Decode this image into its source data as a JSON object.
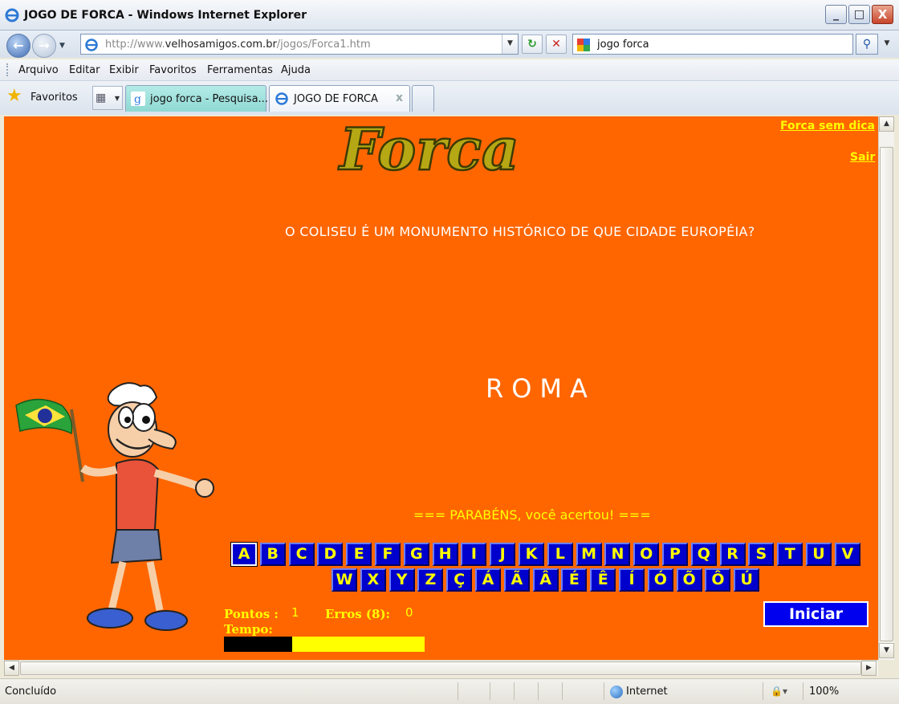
{
  "window": {
    "title": "JOGO DE FORCA - Windows Internet Explorer",
    "minimize": "_",
    "maximize": "□",
    "close": "X"
  },
  "address": {
    "url_prefix": "http://www.",
    "url_host": "velhosamigos.com.br",
    "url_path": "/jogos/Forca1.htm",
    "search_query": "jogo forca"
  },
  "menu": [
    "Arquivo",
    "Editar",
    "Exibir",
    "Favoritos",
    "Ferramentas",
    "Ajuda"
  ],
  "favorites_label": "Favoritos",
  "tabs": [
    {
      "label": "jogo forca - Pesquisa...",
      "icon": "google-icon"
    },
    {
      "label": "JOGO DE FORCA",
      "icon": "ie-icon",
      "close": "x"
    }
  ],
  "page": {
    "logo_text": "Forca",
    "link_forca_sem_dica": "Forca sem dica",
    "link_sair": "Sair",
    "question": "O COLISEU É UM MONUMENTO HISTÓRICO DE QUE CIDADE EUROPÉIA?",
    "answer": "ROMA",
    "message": "=== PARABÉNS, você acertou! ===",
    "letters_row1": [
      "A",
      "B",
      "C",
      "D",
      "E",
      "F",
      "G",
      "H",
      "I",
      "J",
      "K",
      "L",
      "M",
      "N",
      "O",
      "P",
      "Q",
      "R",
      "S",
      "T",
      "U",
      "V"
    ],
    "letters_row2": [
      "W",
      "X",
      "Y",
      "Z",
      "Ç",
      "Á",
      "Ã",
      "Â",
      "É",
      "Ê",
      "Í",
      "Ó",
      "Õ",
      "Ô",
      "Ú"
    ],
    "selected_letter": "A",
    "points_label": "Pontos :",
    "points_value": "1",
    "errors_label": "Erros (8):",
    "errors_value": "0",
    "time_label": "Tempo:",
    "time_elapsed_fraction": 0.34,
    "start_button": "Iniciar"
  },
  "status": {
    "text": "Concluído",
    "zone": "Internet",
    "zoom": "100%"
  },
  "colors": {
    "page_bg": "#ff6600",
    "letter_bg": "#0000cc",
    "letter_text": "#ffff00",
    "accent_yellow": "#ffff00"
  }
}
